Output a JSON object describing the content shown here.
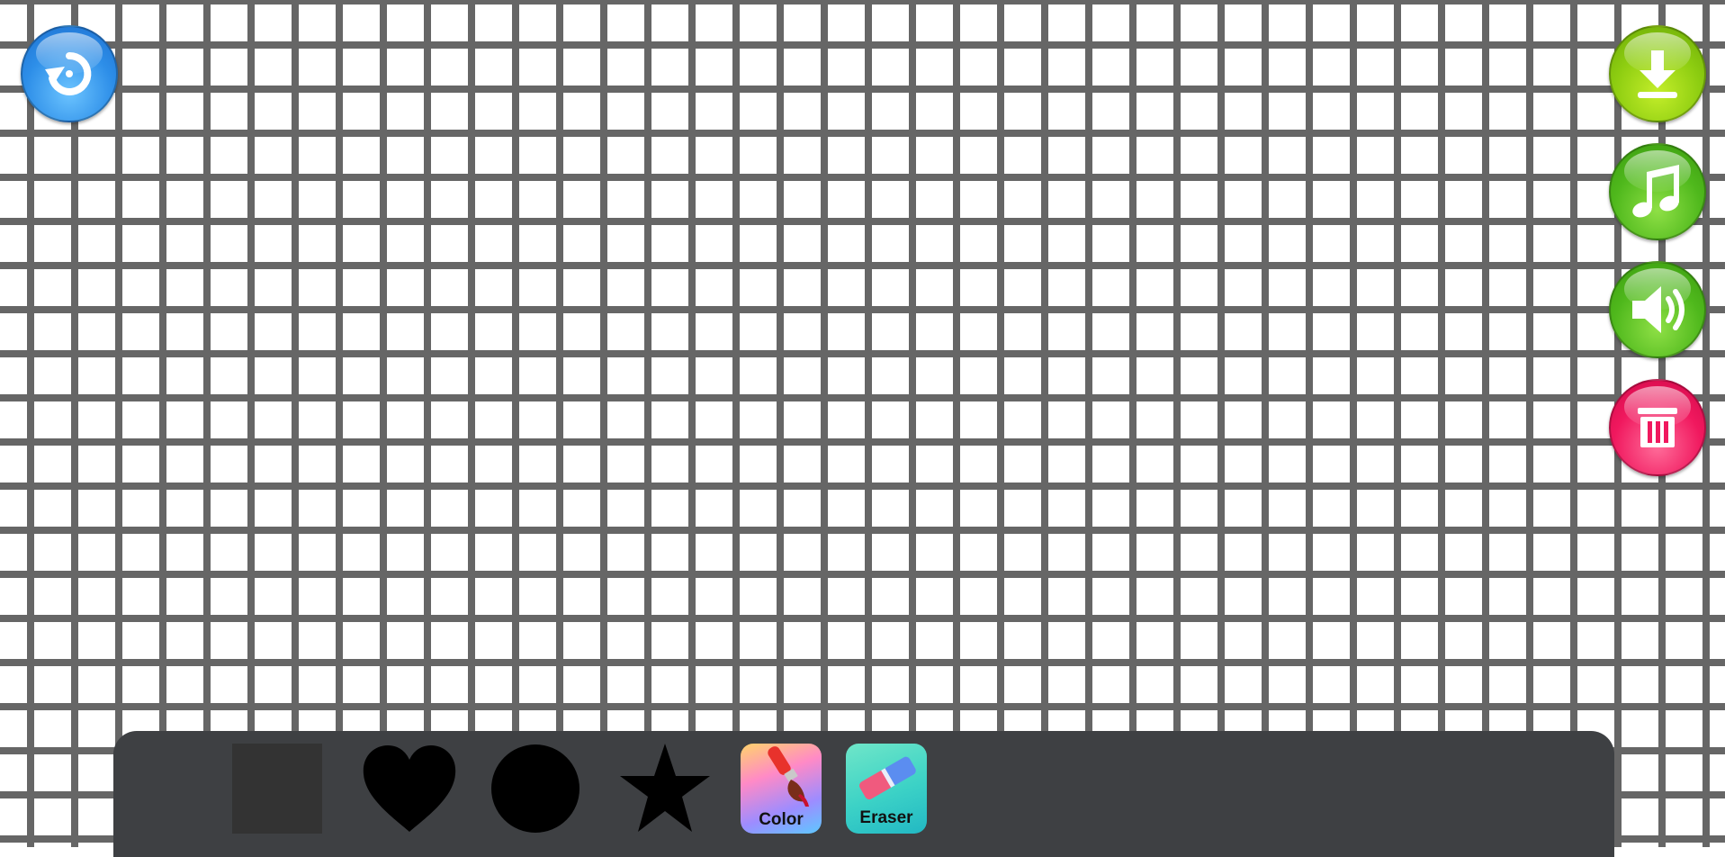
{
  "canvas": {
    "background_color": "#ffffff",
    "grid_line_color": "#666666"
  },
  "controls": {
    "undo": {
      "icon": "undo-icon",
      "color": "#2d8ee8"
    },
    "download": {
      "icon": "download-icon",
      "color": "#8ccc10"
    },
    "music": {
      "icon": "music-note-icon",
      "color": "#4fb81c"
    },
    "sound": {
      "icon": "speaker-icon",
      "color": "#4fb81c"
    },
    "clear": {
      "icon": "trash-icon",
      "color": "#f0185e"
    }
  },
  "toolbar": {
    "background_color": "#3e4043",
    "shapes": [
      {
        "name": "square",
        "icon": "square-shape-icon",
        "color": "#333333"
      },
      {
        "name": "heart",
        "icon": "heart-shape-icon",
        "color": "#000000"
      },
      {
        "name": "circle",
        "icon": "circle-shape-icon",
        "color": "#000000"
      },
      {
        "name": "star",
        "icon": "star-shape-icon",
        "color": "#000000"
      }
    ],
    "color_tool": {
      "label": "Color",
      "icon": "paintbrush-icon"
    },
    "eraser_tool": {
      "label": "Eraser",
      "icon": "eraser-icon"
    }
  }
}
